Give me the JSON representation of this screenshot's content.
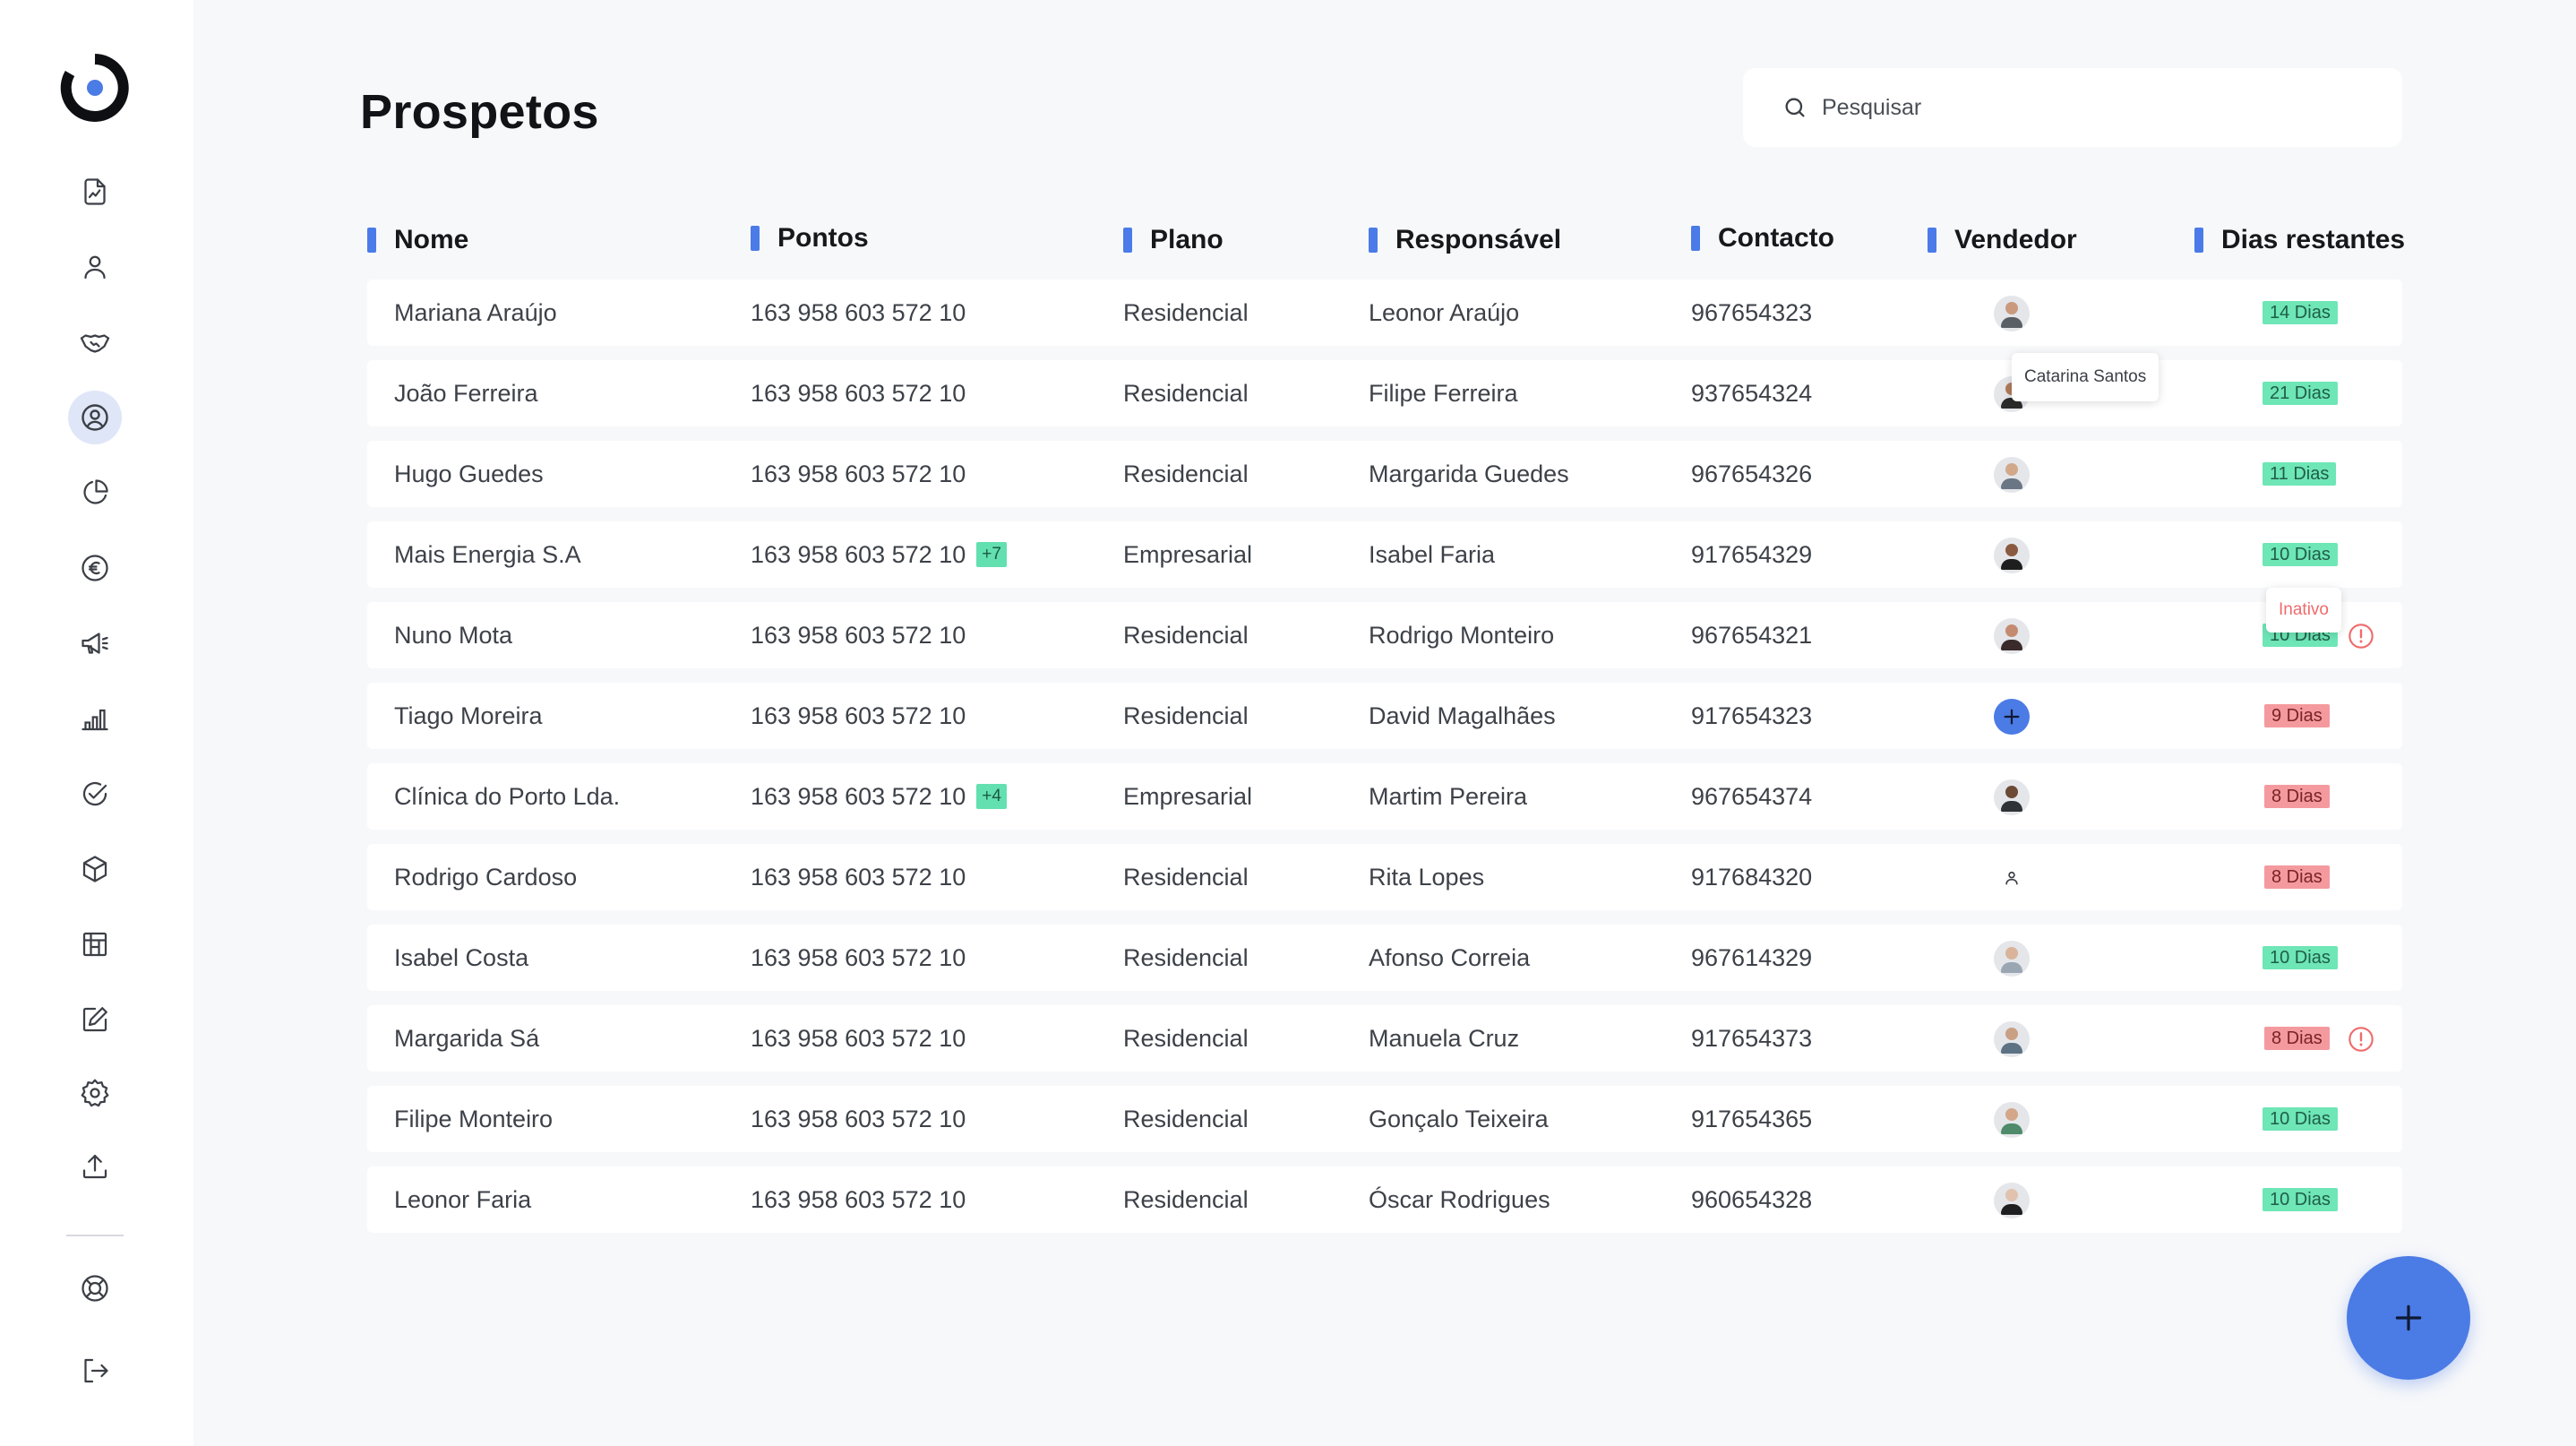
{
  "page": {
    "title": "Prospetos"
  },
  "search": {
    "placeholder": "Pesquisar"
  },
  "sidebar": {
    "items": [
      {
        "icon": "document-chart-icon"
      },
      {
        "icon": "user-icon"
      },
      {
        "icon": "handshake-icon"
      },
      {
        "icon": "user-circle-icon",
        "active": true
      },
      {
        "icon": "pie-chart-icon"
      },
      {
        "icon": "euro-icon"
      },
      {
        "icon": "megaphone-icon"
      },
      {
        "icon": "bar-chart-icon"
      },
      {
        "icon": "check-circle-icon"
      },
      {
        "icon": "box-icon"
      },
      {
        "icon": "building-icon"
      },
      {
        "icon": "edit-icon"
      },
      {
        "icon": "gear-icon"
      },
      {
        "icon": "upload-icon"
      },
      {
        "icon": "lifebuoy-icon"
      },
      {
        "icon": "logout-icon"
      }
    ]
  },
  "table": {
    "columns": [
      "Nome",
      "Pontos",
      "Plano",
      "Responsável",
      "Contacto",
      "Vendedor",
      "Dias restantes"
    ],
    "rows": [
      {
        "nome": "Mariana Araújo",
        "pontos": "163 958 603 572 10",
        "extra": "",
        "plano": "Residencial",
        "responsavel": "Leonor Araújo",
        "contacto": "967654323",
        "avatar": "photo",
        "skin": "#c99a7e",
        "shirt": "#5a5f66",
        "dias": "14 Dias",
        "status": "green",
        "warning": false
      },
      {
        "nome": "João Ferreira",
        "pontos": "163 958 603 572 10",
        "extra": "",
        "plano": "Residencial",
        "responsavel": "Filipe Ferreira",
        "contacto": "937654324",
        "avatar": "photo",
        "skin": "#b07a5a",
        "shirt": "#2b2b2b",
        "dias": "21 Dias",
        "status": "green",
        "warning": false
      },
      {
        "nome": "Hugo Guedes",
        "pontos": "163 958 603 572 10",
        "extra": "",
        "plano": "Residencial",
        "responsavel": "Margarida Guedes",
        "contacto": "967654326",
        "avatar": "photo",
        "skin": "#d2a88a",
        "shirt": "#6b7685",
        "dias": "11 Dias",
        "status": "green",
        "warning": false
      },
      {
        "nome": "Mais Energia S.A",
        "pontos": "163 958 603 572 10",
        "extra": "+7",
        "plano": "Empresarial",
        "responsavel": "Isabel Faria",
        "contacto": "917654329",
        "avatar": "photo",
        "skin": "#8a5a40",
        "shirt": "#1e1e1e",
        "dias": "10 Dias",
        "status": "green",
        "warning": false
      },
      {
        "nome": "Nuno Mota",
        "pontos": "163 958 603 572 10",
        "extra": "",
        "plano": "Residencial",
        "responsavel": "Rodrigo Monteiro",
        "contacto": "967654321",
        "avatar": "photo",
        "skin": "#c48b70",
        "shirt": "#3a2a2a",
        "dias": "10 Dias",
        "status": "green",
        "warning": true
      },
      {
        "nome": "Tiago Moreira",
        "pontos": "163 958 603 572 10",
        "extra": "",
        "plano": "Residencial",
        "responsavel": "David Magalhães",
        "contacto": "917654323",
        "avatar": "add",
        "skin": "",
        "shirt": "",
        "dias": "9 Dias",
        "status": "red",
        "warning": false
      },
      {
        "nome": "Clínica do Porto Lda.",
        "pontos": "163 958 603 572 10",
        "extra": "+4",
        "plano": "Empresarial",
        "responsavel": "Martim Pereira",
        "contacto": "967654374",
        "avatar": "photo",
        "skin": "#6d4a36",
        "shirt": "#2f3338",
        "dias": "8 Dias",
        "status": "red",
        "warning": false
      },
      {
        "nome": "Rodrigo Cardoso",
        "pontos": "163 958 603 572 10",
        "extra": "",
        "plano": "Residencial",
        "responsavel": "Rita Lopes",
        "contacto": "917684320",
        "avatar": "placeholder",
        "skin": "",
        "shirt": "",
        "dias": "8 Dias",
        "status": "red",
        "warning": false
      },
      {
        "nome": "Isabel Costa",
        "pontos": "163 958 603 572 10",
        "extra": "",
        "plano": "Residencial",
        "responsavel": "Afonso Correia",
        "contacto": "967614329",
        "avatar": "photo",
        "skin": "#d9b49b",
        "shirt": "#9aa6b2",
        "dias": "10 Dias",
        "status": "green",
        "warning": false
      },
      {
        "nome": "Margarida Sá",
        "pontos": "163 958 603 572 10",
        "extra": "",
        "plano": "Residencial",
        "responsavel": "Manuela Cruz",
        "contacto": "917654373",
        "avatar": "photo",
        "skin": "#c9a084",
        "shirt": "#5d7284",
        "dias": "8 Dias",
        "status": "red",
        "warning": true
      },
      {
        "nome": "Filipe Monteiro",
        "pontos": "163 958 603 572 10",
        "extra": "",
        "plano": "Residencial",
        "responsavel": "Gonçalo Teixeira",
        "contacto": "917654365",
        "avatar": "photo",
        "skin": "#d4a78a",
        "shirt": "#4f8a6a",
        "dias": "10 Dias",
        "status": "green",
        "warning": false
      },
      {
        "nome": "Leonor Faria",
        "pontos": "163 958 603 572 10",
        "extra": "",
        "plano": "Residencial",
        "responsavel": "Óscar Rodrigues",
        "contacto": "960654328",
        "avatar": "photo",
        "skin": "#e0c2ae",
        "shirt": "#1f1f1f",
        "dias": "10 Dias",
        "status": "green",
        "warning": false
      }
    ]
  },
  "tooltips": {
    "vendedor": "Catarina Santos",
    "status": "Inativo"
  },
  "colors": {
    "accent": "#4b7be5",
    "badge_green": "#6ee6b6",
    "badge_red": "#f49a9e",
    "warning": "#ef6b6b"
  }
}
